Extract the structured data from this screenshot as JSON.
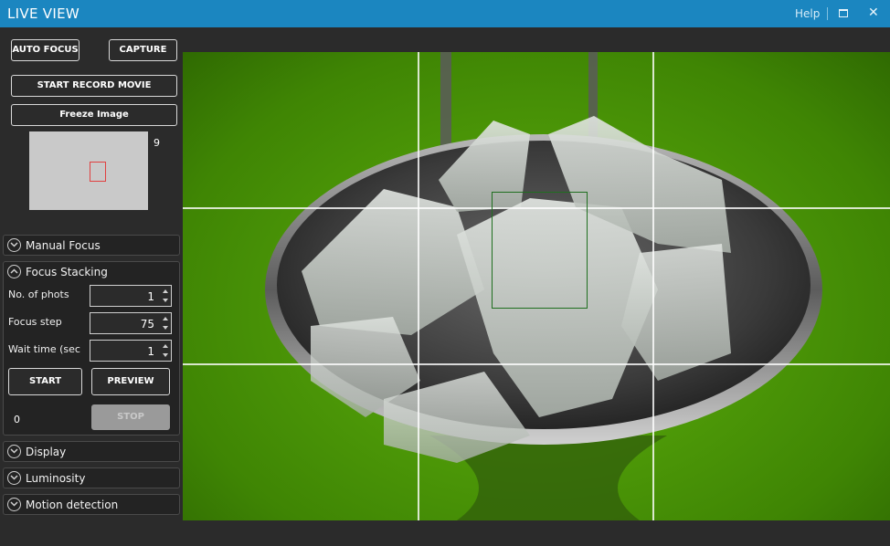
{
  "window": {
    "title": "LIVE VIEW",
    "help_label": "Help",
    "maximize_icon": "maximize-icon",
    "close_glyph": "✕"
  },
  "toolbar": {
    "auto_focus_label": "AUTO FOCUS",
    "capture_label": "CAPTURE",
    "start_record_label": "START RECORD MOVIE",
    "freeze_label": "Freeze Image"
  },
  "focus_map": {
    "count": "9"
  },
  "sections": {
    "manual_focus": "Manual Focus",
    "focus_stacking": "Focus Stacking",
    "display": "Display",
    "luminosity": "Luminosity",
    "motion_detection": "Motion detection"
  },
  "focus_stacking": {
    "photos_label": "No. of phots",
    "photos_value": "1",
    "step_label": "Focus step",
    "step_value": "75",
    "wait_label": "Wait time (sec)",
    "wait_value": "1",
    "start_label": "START",
    "preview_label": "PREVIEW",
    "stop_label": "STOP",
    "progress_value": "0"
  },
  "colors": {
    "titlebar": "#1b86c0",
    "panel_bg": "#2b2b2b",
    "focus_marker": "#e04040",
    "focus_box": "#1f6f1f"
  }
}
